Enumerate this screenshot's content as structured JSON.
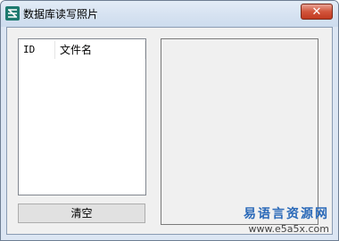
{
  "window": {
    "title": "数据库读写照片",
    "close_symbol": "✕"
  },
  "listview": {
    "columns": [
      {
        "label": "ID"
      },
      {
        "label": "文件名"
      }
    ]
  },
  "buttons": {
    "clear_label": "清空"
  },
  "watermark": {
    "cn": "易语言资源网",
    "url": "www.e5a5x.com"
  },
  "colors": {
    "titlebar": "#d6e2f1",
    "close_button": "#c13a20",
    "client_bg": "#f0f0f0",
    "app_icon": "#1d7a6f"
  },
  "icons": {
    "app": "app-icon",
    "close": "close-icon"
  }
}
